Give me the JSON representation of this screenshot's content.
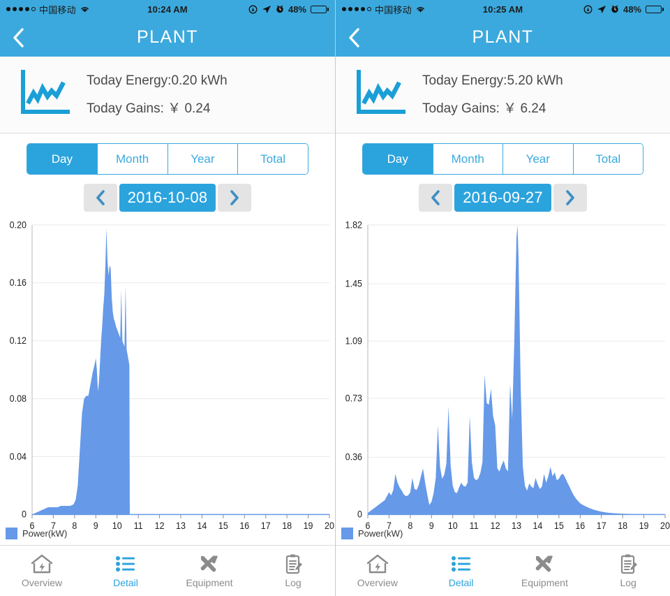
{
  "panels": [
    {
      "status": {
        "carrier": "中国移动",
        "time": "10:24 AM",
        "battery_pct": "48%",
        "signal_dots_filled": 4,
        "signal_dots_total": 5,
        "icons": [
          "rotation-lock-icon",
          "location-arrow-icon",
          "alarm-clock-icon",
          "battery-icon"
        ]
      },
      "nav": {
        "title": "PLANT",
        "back_icon": "chevron-left-icon"
      },
      "summary": {
        "icon": "line-chart-icon",
        "energy_line": "Today Energy:0.20 kWh",
        "gains_line": "Today Gains: ￥ 0.24"
      },
      "segment": {
        "options": [
          "Day",
          "Month",
          "Year",
          "Total"
        ],
        "selected": "Day"
      },
      "date": {
        "value": "2016-10-08",
        "prev_icon": "chevron-left-icon",
        "next_icon": "chevron-right-icon"
      },
      "tabbar": {
        "items": [
          {
            "label": "Overview",
            "icon": "house-bolt-icon",
            "active": false
          },
          {
            "label": "Detail",
            "icon": "list-icon",
            "active": true
          },
          {
            "label": "Equipment",
            "icon": "tools-icon",
            "active": false
          },
          {
            "label": "Log",
            "icon": "clipboard-pencil-icon",
            "active": false
          }
        ]
      }
    },
    {
      "status": {
        "carrier": "中国移动",
        "time": "10:25 AM",
        "battery_pct": "48%",
        "signal_dots_filled": 4,
        "signal_dots_total": 5,
        "icons": [
          "rotation-lock-icon",
          "location-arrow-icon",
          "alarm-clock-icon",
          "battery-icon"
        ]
      },
      "nav": {
        "title": "PLANT",
        "back_icon": "chevron-left-icon"
      },
      "summary": {
        "icon": "line-chart-icon",
        "energy_line": "Today Energy:5.20 kWh",
        "gains_line": "Today Gains: ￥ 6.24"
      },
      "segment": {
        "options": [
          "Day",
          "Month",
          "Year",
          "Total"
        ],
        "selected": "Day"
      },
      "date": {
        "value": "2016-09-27",
        "prev_icon": "chevron-left-icon",
        "next_icon": "chevron-right-icon"
      },
      "tabbar": {
        "items": [
          {
            "label": "Overview",
            "icon": "house-bolt-icon",
            "active": false
          },
          {
            "label": "Detail",
            "icon": "list-icon",
            "active": true
          },
          {
            "label": "Equipment",
            "icon": "tools-icon",
            "active": false
          },
          {
            "label": "Log",
            "icon": "clipboard-pencil-icon",
            "active": false
          }
        ]
      }
    }
  ],
  "colors": {
    "brand": "#3ba9dd",
    "accent": "#2ba3dd",
    "chart_fill": "#6699e8",
    "grid": "#ebebeb",
    "axis": "#9a9a9a",
    "text_muted": "#8b8b8b"
  },
  "chart_data": [
    {
      "type": "area",
      "title": "",
      "xlabel": "",
      "ylabel": "",
      "legend": [
        "Power(kW)"
      ],
      "legend_position": "bottom-left",
      "grid": true,
      "xlim": [
        6,
        20
      ],
      "ylim": [
        0,
        0.2
      ],
      "xticks": [
        6,
        7,
        8,
        9,
        10,
        11,
        12,
        13,
        14,
        15,
        16,
        17,
        18,
        19,
        20
      ],
      "xtick_labels": [
        "6",
        "7",
        "8",
        "9",
        "10",
        "11",
        "12",
        "13",
        "14",
        "15",
        "16",
        "17",
        "18",
        "19",
        "20"
      ],
      "yticks": [
        0,
        0.04,
        0.08,
        0.12,
        0.16,
        0.2
      ],
      "ytick_labels": [
        "0",
        "0.04",
        "0.08",
        "0.12",
        "0.16",
        "0.20"
      ],
      "series": [
        {
          "name": "Power(kW)",
          "x": [
            6.0,
            6.15,
            6.3,
            6.45,
            6.6,
            6.75,
            6.9,
            7.05,
            7.2,
            7.35,
            7.5,
            7.65,
            7.8,
            7.95,
            8.05,
            8.15,
            8.25,
            8.35,
            8.45,
            8.55,
            8.65,
            8.75,
            8.85,
            8.95,
            9.0,
            9.05,
            9.1,
            9.15,
            9.2,
            9.25,
            9.3,
            9.35,
            9.4,
            9.45,
            9.5,
            9.55,
            9.6,
            9.65,
            9.7,
            9.75,
            9.8,
            9.85,
            9.9,
            9.95,
            10.0,
            10.05,
            10.1,
            10.15,
            10.2,
            10.25,
            10.3,
            10.35,
            10.4,
            10.45,
            10.5,
            10.55,
            10.58,
            10.6,
            11.0,
            12.0,
            14.0,
            16.0,
            18.0,
            20.0
          ],
          "y": [
            0.0,
            0.001,
            0.002,
            0.003,
            0.004,
            0.005,
            0.005,
            0.005,
            0.005,
            0.006,
            0.006,
            0.006,
            0.006,
            0.007,
            0.01,
            0.02,
            0.045,
            0.07,
            0.08,
            0.082,
            0.082,
            0.09,
            0.098,
            0.104,
            0.108,
            0.1,
            0.085,
            0.092,
            0.106,
            0.12,
            0.13,
            0.143,
            0.152,
            0.172,
            0.198,
            0.175,
            0.165,
            0.172,
            0.17,
            0.15,
            0.14,
            0.135,
            0.133,
            0.13,
            0.128,
            0.126,
            0.124,
            0.122,
            0.155,
            0.12,
            0.118,
            0.116,
            0.158,
            0.114,
            0.11,
            0.106,
            0.103,
            0.0,
            0.0,
            0.0,
            0.0,
            0.0,
            0.0,
            0.0
          ]
        }
      ]
    },
    {
      "type": "area",
      "title": "",
      "xlabel": "",
      "ylabel": "",
      "legend": [
        "Power(kW)"
      ],
      "legend_position": "bottom-left",
      "grid": true,
      "xlim": [
        6,
        20
      ],
      "ylim": [
        0,
        1.82
      ],
      "xticks": [
        6,
        7,
        8,
        9,
        10,
        11,
        12,
        13,
        14,
        15,
        16,
        17,
        18,
        19,
        20
      ],
      "xtick_labels": [
        "6",
        "7",
        "8",
        "9",
        "10",
        "11",
        "12",
        "13",
        "14",
        "15",
        "16",
        "17",
        "18",
        "19",
        "20"
      ],
      "yticks": [
        0,
        0.36,
        0.73,
        1.09,
        1.45,
        1.82
      ],
      "ytick_labels": [
        "0",
        "0.36",
        "0.73",
        "1.09",
        "1.45",
        "1.82"
      ],
      "series": [
        {
          "name": "Power(kW)",
          "x": [
            6.0,
            6.2,
            6.4,
            6.6,
            6.8,
            7.0,
            7.1,
            7.2,
            7.3,
            7.4,
            7.5,
            7.6,
            7.7,
            7.8,
            7.9,
            8.0,
            8.1,
            8.2,
            8.3,
            8.4,
            8.5,
            8.6,
            8.7,
            8.8,
            8.9,
            9.0,
            9.1,
            9.2,
            9.3,
            9.4,
            9.5,
            9.6,
            9.7,
            9.8,
            9.9,
            10.0,
            10.1,
            10.2,
            10.3,
            10.4,
            10.5,
            10.6,
            10.7,
            10.8,
            10.9,
            11.0,
            11.1,
            11.2,
            11.3,
            11.4,
            11.5,
            11.6,
            11.7,
            11.8,
            11.9,
            12.0,
            12.1,
            12.2,
            12.3,
            12.4,
            12.5,
            12.6,
            12.7,
            12.8,
            12.9,
            13.0,
            13.05,
            13.1,
            13.2,
            13.3,
            13.4,
            13.5,
            13.6,
            13.7,
            13.8,
            13.9,
            14.0,
            14.1,
            14.2,
            14.3,
            14.4,
            14.5,
            14.6,
            14.7,
            14.8,
            14.9,
            15.0,
            15.1,
            15.2,
            15.3,
            15.4,
            15.5,
            15.6,
            15.7,
            15.8,
            15.9,
            16.0,
            16.2,
            16.4,
            16.6,
            16.8,
            17.0,
            17.2,
            17.4,
            17.6,
            18.0,
            18.5,
            19.0,
            19.5,
            20.0
          ],
          "y": [
            0.01,
            0.03,
            0.05,
            0.07,
            0.09,
            0.14,
            0.12,
            0.155,
            0.255,
            0.2,
            0.17,
            0.15,
            0.125,
            0.115,
            0.12,
            0.14,
            0.23,
            0.16,
            0.155,
            0.185,
            0.24,
            0.29,
            0.2,
            0.125,
            0.06,
            0.08,
            0.135,
            0.23,
            0.56,
            0.3,
            0.225,
            0.25,
            0.32,
            0.68,
            0.31,
            0.18,
            0.14,
            0.135,
            0.17,
            0.2,
            0.18,
            0.175,
            0.2,
            0.62,
            0.33,
            0.23,
            0.215,
            0.225,
            0.26,
            0.33,
            0.88,
            0.7,
            0.69,
            0.79,
            0.62,
            0.56,
            0.29,
            0.27,
            0.31,
            0.34,
            0.29,
            0.27,
            0.82,
            0.6,
            1.1,
            1.74,
            1.82,
            1.6,
            0.8,
            0.3,
            0.18,
            0.15,
            0.195,
            0.175,
            0.165,
            0.23,
            0.19,
            0.16,
            0.175,
            0.255,
            0.2,
            0.24,
            0.3,
            0.24,
            0.265,
            0.215,
            0.225,
            0.25,
            0.255,
            0.23,
            0.2,
            0.175,
            0.145,
            0.12,
            0.1,
            0.085,
            0.07,
            0.055,
            0.042,
            0.032,
            0.024,
            0.018,
            0.013,
            0.01,
            0.008,
            0.005,
            0.003,
            0.002,
            0.001,
            0.0
          ]
        }
      ]
    }
  ]
}
